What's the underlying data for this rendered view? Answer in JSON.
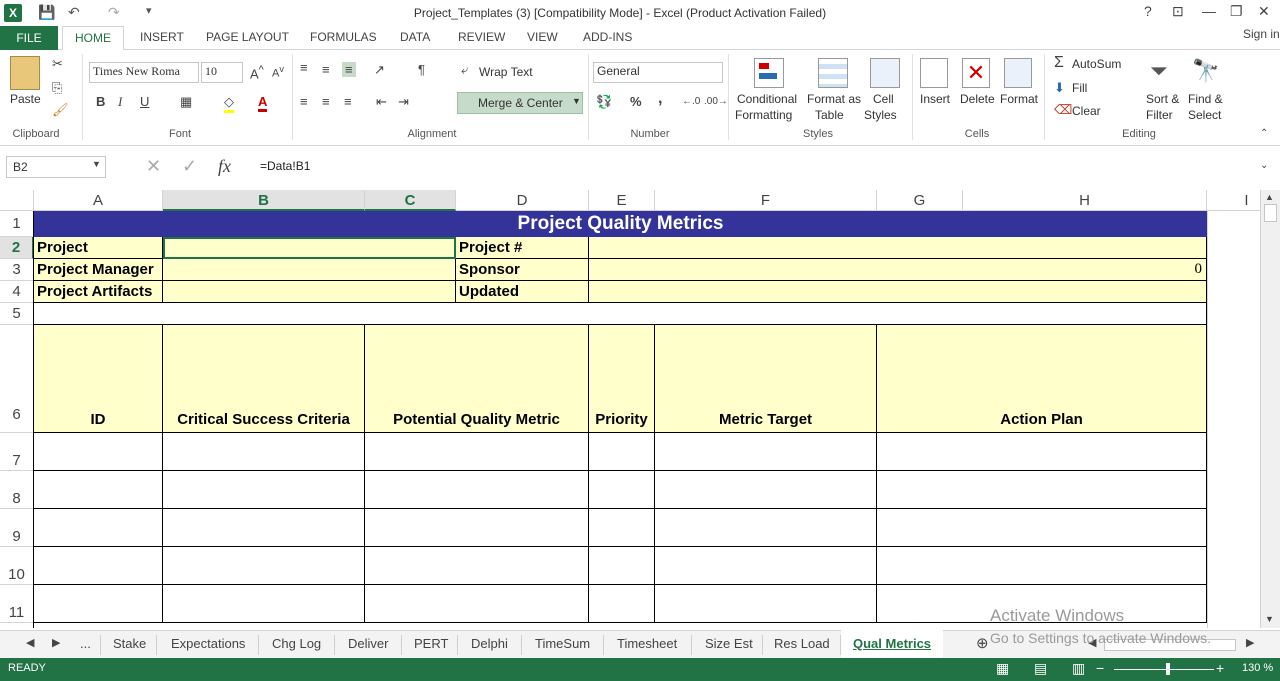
{
  "window": {
    "title": "Project_Templates (3)  [Compatibility Mode] - Excel (Product Activation Failed)",
    "help": "?",
    "minimize": "—",
    "restore": "❐",
    "close": "✕",
    "ribbon_display": "⊡"
  },
  "ribbon_tabs": [
    "FILE",
    "HOME",
    "INSERT",
    "PAGE LAYOUT",
    "FORMULAS",
    "DATA",
    "REVIEW",
    "VIEW",
    "ADD-INS"
  ],
  "signin": "Sign in",
  "clipboard": {
    "paste": "Paste",
    "label": "Clipboard"
  },
  "font": {
    "name": "Times New Roma",
    "size": "10",
    "label": "Font",
    "bold": "B",
    "italic": "I",
    "underline": "U"
  },
  "alignment": {
    "wrap": "Wrap Text",
    "merge": "Merge & Center",
    "label": "Alignment"
  },
  "number": {
    "format": "General",
    "label": "Number",
    "percent": "%",
    "comma": ","
  },
  "styles": {
    "cond1": "Conditional",
    "cond2": "Formatting",
    "fmt1": "Format as",
    "fmt2": "Table",
    "cell1": "Cell",
    "cell2": "Styles",
    "label": "Styles"
  },
  "cells": {
    "insert": "Insert",
    "delete": "Delete",
    "format": "Format",
    "label": "Cells"
  },
  "editing": {
    "autosum": "AutoSum",
    "fill": "Fill",
    "clear": "Clear",
    "sort1": "Sort &",
    "sort2": "Filter",
    "find1": "Find &",
    "find2": "Select",
    "label": "Editing"
  },
  "formula_bar": {
    "name_box": "B2",
    "formula": "=Data!B1",
    "fx": "fx",
    "cancel": "✕",
    "enter": "✓"
  },
  "columns": [
    "A",
    "B",
    "C",
    "D",
    "E",
    "F",
    "G",
    "H",
    "I"
  ],
  "rows": [
    "1",
    "2",
    "3",
    "4",
    "5",
    "6",
    "7",
    "8",
    "9",
    "10",
    "11"
  ],
  "sheet": {
    "title": "Project Quality Metrics",
    "project": "Project",
    "project_num": "Project #",
    "manager": "Project Manager",
    "sponsor": "Sponsor",
    "sponsor_value": "0",
    "artifacts": "Project Artifacts",
    "updated": "Updated",
    "headers": [
      "ID",
      "Critical Success Criteria",
      "Potential Quality Metric",
      "Priority",
      "Metric Target",
      "Action Plan"
    ]
  },
  "sheet_tabs": [
    "...",
    "Stake",
    "Expectations",
    "Chg Log",
    "Deliver",
    "PERT",
    "Delphi",
    "TimeSum",
    "Timesheet",
    "Size Est",
    "Res Load",
    "Qual Metrics"
  ],
  "status": {
    "ready": "READY",
    "zoom": "130 %"
  },
  "watermark": {
    "line1": "Activate Windows",
    "line2": "Go to Settings to activate Windows."
  },
  "colors": {
    "accent": "#217346",
    "title_bg": "#333399",
    "cell_yellow": "#ffffcc"
  }
}
